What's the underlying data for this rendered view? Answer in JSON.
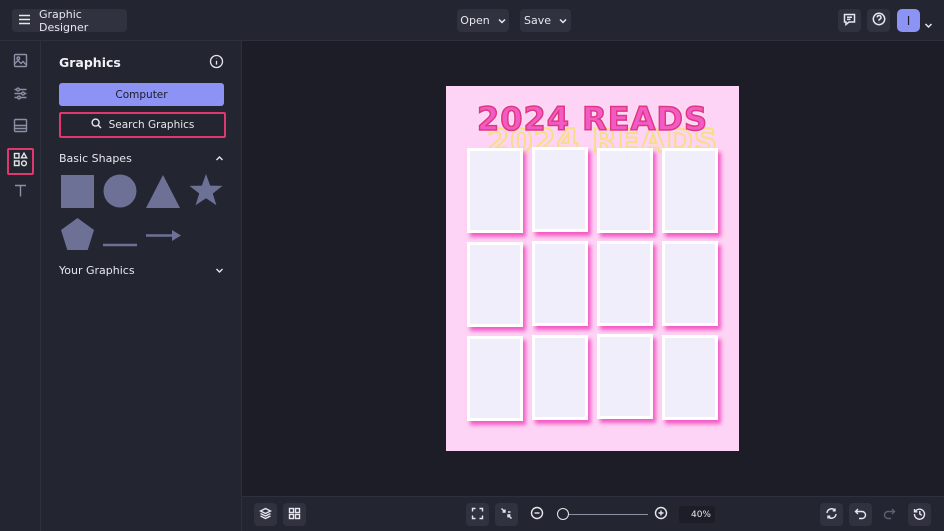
{
  "topbar": {
    "app_title": "Graphic Designer",
    "open_label": "Open",
    "save_label": "Save",
    "avatar_letter": "I"
  },
  "rail": {
    "items": [
      "image-icon",
      "sliders-icon",
      "layout-icon",
      "shapes-icon",
      "text-icon"
    ],
    "active": "shapes-icon"
  },
  "panel": {
    "title": "Graphics",
    "computer_label": "Computer",
    "search_label": "Search Graphics",
    "basic_shapes_label": "Basic Shapes",
    "your_graphics_label": "Your Graphics",
    "shapes": [
      "square",
      "circle",
      "triangle",
      "star",
      "pentagon",
      "line",
      "arrow"
    ]
  },
  "canvas": {
    "poster_title": "2024 READS",
    "poster_bg": "#fdd4f5",
    "title_color": "#f25bc7",
    "frame_count": 12
  },
  "bottombar": {
    "zoom_value": "40%"
  },
  "colors": {
    "accent": "#8c93f5",
    "highlight": "#e0386e",
    "background": "#1c1d27",
    "panel": "#232530"
  }
}
